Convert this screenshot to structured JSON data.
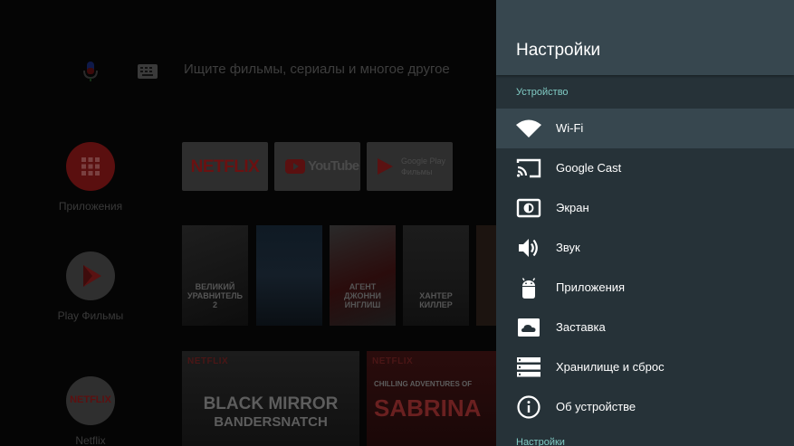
{
  "home": {
    "search": {
      "mic_icon": "mic-icon",
      "keyboard_icon": "keyboard-icon",
      "placeholder": "Ищите фильмы, сериалы и многое другое"
    },
    "side_items": [
      {
        "label": "Приложения",
        "icon": "apps-grid-icon"
      },
      {
        "label": "Play Фильмы",
        "icon": "play-movies-icon"
      },
      {
        "label": "Netflix",
        "icon": "netflix-icon"
      }
    ],
    "app_tiles": [
      {
        "label": "NETFLIX"
      },
      {
        "label": "YouTube"
      },
      {
        "label": "Google Play",
        "sublabel": "Фильмы"
      }
    ],
    "posters": [
      {
        "caption": "ВЕЛИКИЙ УРАВНИТЕЛЬ 2"
      },
      {
        "caption": ""
      },
      {
        "caption": "АГЕНТ ДЖОННИ ИНГЛИШ"
      },
      {
        "caption": "ХАНТЕР КИЛЛЕР"
      }
    ],
    "banners": [
      {
        "brand": "NETFLIX",
        "line1": "BLACK MIRROR",
        "line2": "BANDERSNATCH"
      },
      {
        "brand": "NETFLIX",
        "line1": "CHILLING ADVENTURES OF",
        "line2": "SABRINA"
      }
    ]
  },
  "settings": {
    "title": "Настройки",
    "section_device": "Устройство",
    "items": [
      {
        "label": "Wi-Fi",
        "icon": "wifi-icon"
      },
      {
        "label": "Google Cast",
        "icon": "cast-icon"
      },
      {
        "label": "Экран",
        "icon": "display-icon"
      },
      {
        "label": "Звук",
        "icon": "volume-icon"
      },
      {
        "label": "Приложения",
        "icon": "android-icon"
      },
      {
        "label": "Заставка",
        "icon": "screensaver-icon"
      },
      {
        "label": "Хранилище и сброс",
        "icon": "storage-icon"
      },
      {
        "label": "Об устройстве",
        "icon": "info-icon"
      }
    ],
    "section_settings": "Настройки"
  },
  "colors": {
    "panel_bg": "#263238",
    "header_bg": "#37474f",
    "focus_bg": "#37474f",
    "accent": "#80cbc4",
    "netflix_red": "#e50914"
  }
}
